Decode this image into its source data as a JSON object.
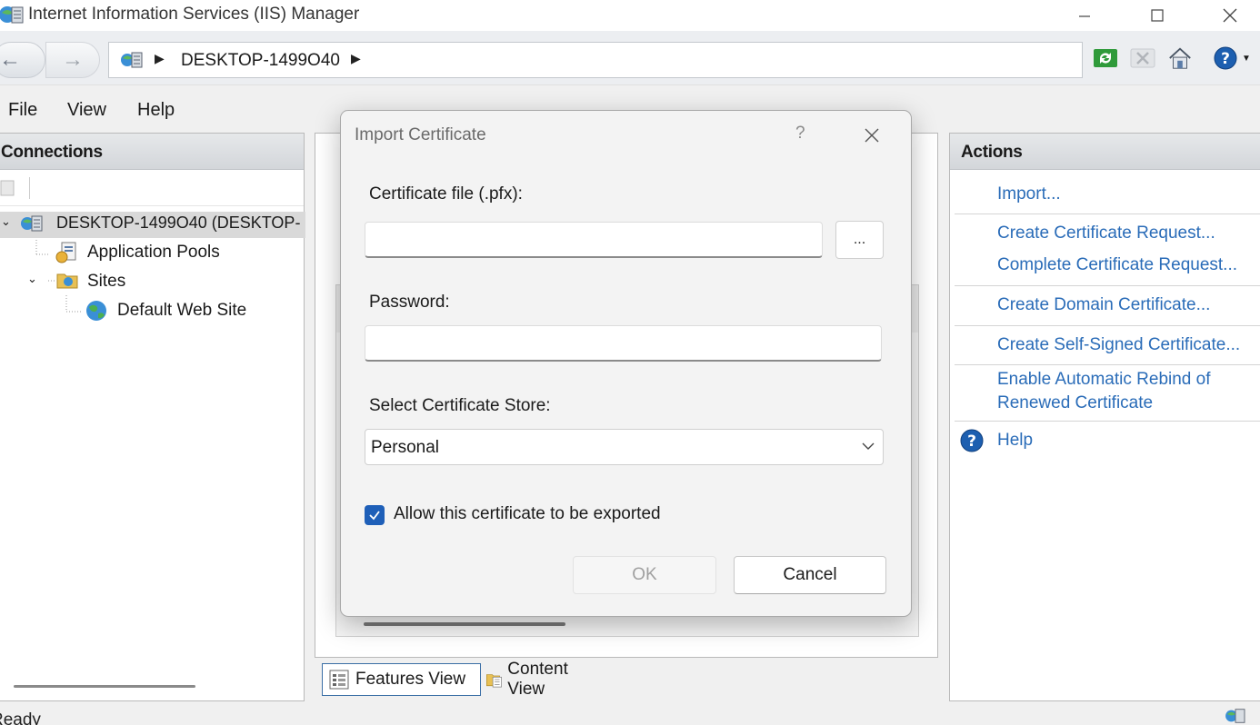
{
  "window": {
    "title": "Internet Information Services (IIS) Manager",
    "minimize_icon": "minimize-icon",
    "maximize_icon": "maximize-icon",
    "close_icon": "close-icon"
  },
  "address_bar": {
    "crumbs": [
      "DESKTOP-1499O40"
    ],
    "icon": "server-icon"
  },
  "menu": [
    "File",
    "View",
    "Help"
  ],
  "connections": {
    "header": "Connections",
    "tree": [
      {
        "label": "DESKTOP-1499O40 (DESKTOP-",
        "icon": "server-icon",
        "expanded": true
      },
      {
        "label": "Application Pools",
        "icon": "app-pool-icon"
      },
      {
        "label": "Sites",
        "icon": "folder-icon",
        "expanded": true
      },
      {
        "label": "Default Web Site",
        "icon": "globe-icon"
      }
    ]
  },
  "view_tabs": {
    "features": "Features View",
    "content": "Content View"
  },
  "actions": {
    "header": "Actions",
    "items": [
      "Import...",
      "Create Certificate Request...",
      "Complete Certificate Request...",
      "Create Domain Certificate...",
      "Create Self-Signed Certificate...",
      "Enable Automatic Rebind of",
      "Renewed Certificate",
      "Help"
    ]
  },
  "status": {
    "text": "Ready"
  },
  "dialog": {
    "title": "Import Certificate",
    "help_glyph": "?",
    "cert_file_label": "Certificate file (.pfx):",
    "cert_file_value": "",
    "browse_label": "...",
    "password_label": "Password:",
    "password_value": "",
    "store_label": "Select Certificate Store:",
    "store_value": "Personal",
    "export_label": "Allow this certificate to be exported",
    "export_checked": true,
    "ok_label": "OK",
    "cancel_label": "Cancel"
  },
  "colors": {
    "link": "#2a6cb8",
    "checkbox": "#1e5fb8"
  }
}
